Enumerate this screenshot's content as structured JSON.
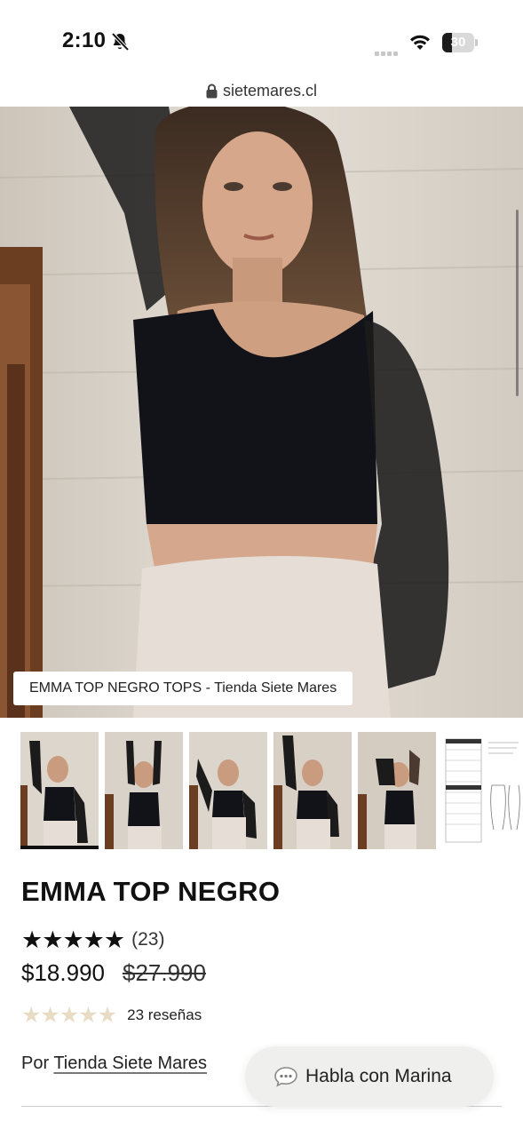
{
  "status_bar": {
    "time": "2:10",
    "battery_level": "30",
    "battery_fraction": 0.3
  },
  "browser": {
    "url": "sietemares.cl"
  },
  "gallery": {
    "caption": "EMMA TOP NEGRO TOPS - Tienda Siete Mares",
    "thumbnail_count": 6,
    "active_index": 0
  },
  "product": {
    "title": "EMMA TOP NEGRO",
    "rating_stars": 5,
    "rating_count": "(23)",
    "price": "$18.990",
    "price_compare": "$27.990",
    "reviews_label": "23 reseñas",
    "vendor_prefix": "Por",
    "vendor_name": "Tienda Siete Mares"
  },
  "chat": {
    "label": "Habla con Marina"
  },
  "colors": {
    "star_dark": "#111111",
    "star_light": "#e8dcc4",
    "chat_bg": "#efefed"
  }
}
